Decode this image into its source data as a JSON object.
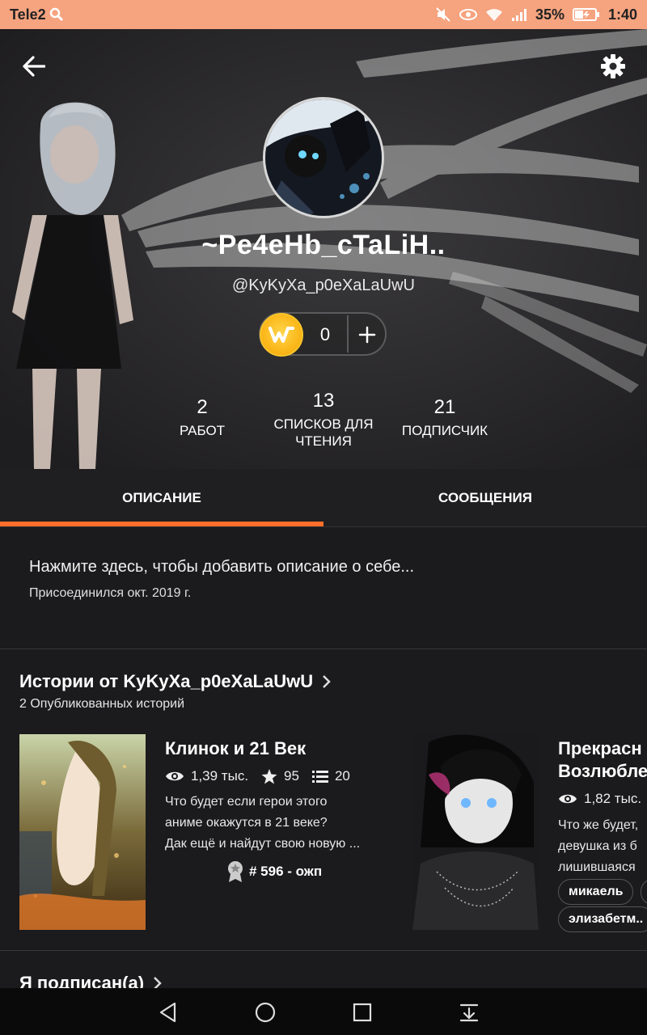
{
  "status_bar": {
    "carrier": "Tele2",
    "battery": "35%",
    "time": "1:40"
  },
  "profile": {
    "display_name": "~Pe4eHb_cTaLiH..",
    "username": "@KyKyXa_p0eXaLaUwU",
    "coins": "0",
    "stats": [
      {
        "num": "2",
        "label": "РАБОТ"
      },
      {
        "num": "13",
        "label": "СПИСКОВ ДЛЯ ЧТЕНИЯ"
      },
      {
        "num": "21",
        "label": "ПОДПИСЧИК"
      }
    ]
  },
  "tabs": [
    {
      "label": "ОПИСАНИЕ",
      "active": true
    },
    {
      "label": "СООБЩЕНИЯ",
      "active": false
    }
  ],
  "about": {
    "prompt": "Нажмите здесь, чтобы добавить описание о себе...",
    "joined": "Присоединился окт. 2019 г."
  },
  "stories_section": {
    "title": "Истории от KyKyXa_p0eXaLaUwU",
    "subtitle": "2 Опубликованных историй"
  },
  "stories": [
    {
      "title": "Клинок и 21 Век",
      "reads": "1,39 тыс.",
      "votes": "95",
      "parts": "20",
      "desc_lines": [
        "Что будет если герои этого",
        "аниме окажутся в 21 веке?",
        "Дак ещё и найдут свою новую ..."
      ],
      "rank": "# 596 - ожп"
    },
    {
      "title_lines": [
        "Прекрасн",
        "Возлюбле"
      ],
      "reads": "1,82 тыс.",
      "desc_lines": [
        "Что же будет,",
        "девушка из б",
        "лишившаяся"
      ],
      "tags": [
        "микаель",
        "элизабетм.."
      ]
    }
  ],
  "following_section": {
    "title": "Я подписан(а)"
  },
  "icons": {
    "back": "arrow-left-icon",
    "settings": "gear-icon",
    "coin": "wattpad-coin-icon",
    "add": "plus-icon",
    "reads": "eye-icon",
    "votes": "star-icon",
    "parts": "list-icon",
    "rank": "award-icon"
  },
  "colors": {
    "accent": "#ff6e2b",
    "status_bar": "#f6a37f",
    "background": "#1b1a1c",
    "coin": "#fbb81b"
  }
}
